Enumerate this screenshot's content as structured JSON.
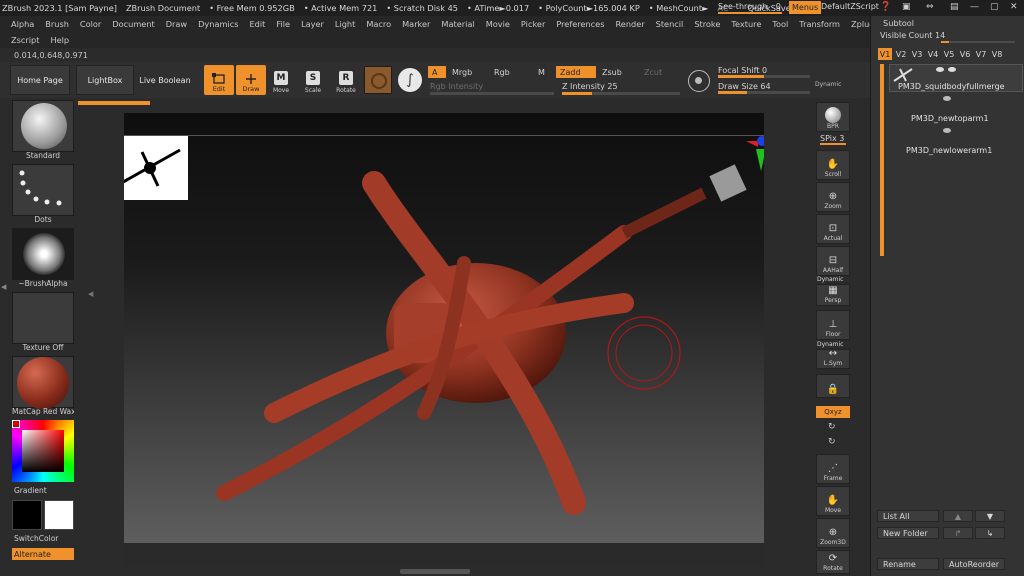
{
  "titlebar": {
    "app": "ZBrush 2023.1 [Sam Payne]",
    "doc": "ZBrush Document",
    "free_mem": "• Free Mem 0.952GB",
    "active_mem": "• Active Mem 721",
    "scratch": "• Scratch Disk 45",
    "atime": "• ATime►0.017",
    "polycount": "• PolyCount►165.004 KP",
    "meshcount": "• MeshCount►",
    "ac": "AC",
    "quicksave": "QuickSave",
    "seethrough": "See-through",
    "seethrough_val": "0",
    "menus": "Menus",
    "defaultzscript": "DefaultZScript"
  },
  "menu": [
    "Alpha",
    "Brush",
    "Color",
    "Document",
    "Draw",
    "Dynamics",
    "Edit",
    "File",
    "Layer",
    "Light",
    "Macro",
    "Marker",
    "Material",
    "Movie",
    "Picker",
    "Preferences",
    "Render",
    "Stencil",
    "Stroke",
    "Texture",
    "Tool",
    "Transform",
    "Zplugin"
  ],
  "menu2": [
    "Zscript",
    "Help"
  ],
  "coords": "0.014,0.648,0.971",
  "toolbar": {
    "home": "Home Page",
    "lightbox": "LightBox",
    "liveboolean": "Live Boolean",
    "edit": "Edit",
    "draw": "Draw",
    "move": "Move",
    "scale": "Scale",
    "rotate": "Rotate",
    "move_letter": "M",
    "scale_letter": "S",
    "rotate_letter": "R",
    "a": "A",
    "mrgb": "Mrgb",
    "rgb": "Rgb",
    "m": "M",
    "zadd": "Zadd",
    "zsub": "Zsub",
    "zcut": "Zcut",
    "rgb_intensity": "Rgb Intensity",
    "z_intensity": "Z Intensity 25",
    "focal_shift": "Focal Shift 0",
    "draw_size": "Draw Size 64",
    "dynamic": "Dynamic",
    "z_intensity_value": 25,
    "focal_shift_value": 0,
    "draw_size_value": 64
  },
  "left": {
    "standard": "Standard",
    "dots": "Dots",
    "brushalpha": "~BrushAlpha",
    "texture": "Texture Off",
    "matcap": "MatCap Red Wax",
    "gradient": "Gradient",
    "switchcolor": "SwitchColor",
    "alternate": "Alternate"
  },
  "right": {
    "bpr": "BPR",
    "spix": "SPix 3",
    "scroll": "Scroll",
    "zoom": "Zoom",
    "actual": "Actual",
    "aahalf": "AAHalf",
    "dynamic": "Dynamic",
    "persp": "Persp",
    "floor": "Floor",
    "dynamic2": "Dynamic",
    "lsym": "L.Sym",
    "xyz": "Qxyz",
    "frame": "Frame",
    "move": "Move",
    "zoom3d": "Zoom3D",
    "rotate": "Rotate"
  },
  "subtool": {
    "title": "Subtool",
    "visible_count": "Visible Count 14",
    "versions": [
      "V1",
      "V2",
      "V3",
      "V4",
      "V5",
      "V6",
      "V7",
      "V8"
    ],
    "items": [
      "PM3D_squidbodyfullmerge",
      "PM3D_newtoparm1",
      "PM3D_newlowerarm1"
    ],
    "list_all": "List All",
    "new_folder": "New Folder",
    "rename": "Rename",
    "autoreorder": "AutoReorder"
  },
  "colors": {
    "accent": "#f0922c",
    "bg": "#2b2b2b",
    "clay": "#9a3524"
  }
}
